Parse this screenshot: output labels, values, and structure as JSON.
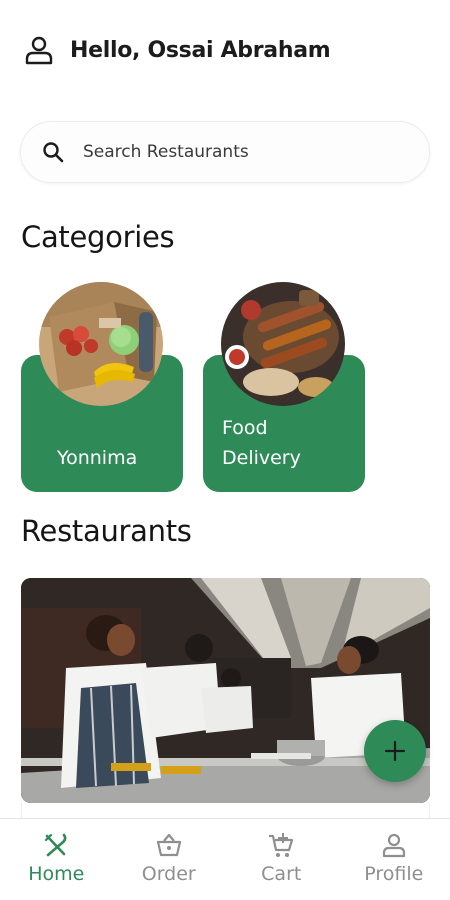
{
  "header": {
    "greeting": "Hello, Ossai Abraham",
    "icon": "user-icon"
  },
  "search": {
    "placeholder": "Search Restaurants",
    "icon": "search-icon"
  },
  "sections": {
    "categories": "Categories",
    "restaurants": "Restaurants"
  },
  "categories": [
    {
      "line1": "Yonnima",
      "line2": ""
    },
    {
      "line1": "Food",
      "line2": "Delivery"
    }
  ],
  "fab": {
    "icon": "plus-icon"
  },
  "bottom_nav": [
    {
      "label": "Home",
      "icon": "fork-knife-icon",
      "active": true
    },
    {
      "label": "Order",
      "icon": "basket-icon",
      "active": false
    },
    {
      "label": "Cart",
      "icon": "cart-icon",
      "active": false
    },
    {
      "label": "Profile",
      "icon": "person-icon",
      "active": false
    }
  ],
  "colors": {
    "accent": "#2e8b57",
    "inactive": "#8f8f8f"
  }
}
